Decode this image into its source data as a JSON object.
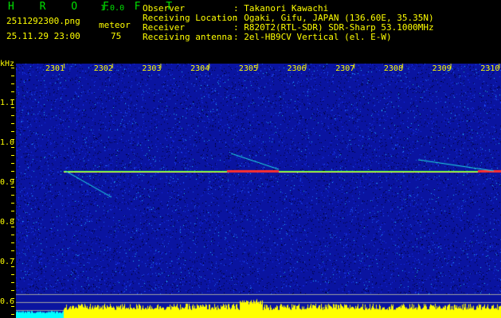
{
  "app": {
    "name": "H R O F F T",
    "version": "1.0.0"
  },
  "file": {
    "name": "2511292300.png",
    "datetime": "25.11.29 23:00"
  },
  "meteor": {
    "label": "meteor",
    "count": "75"
  },
  "info": [
    {
      "key": "Observer",
      "value": ": Takanori Kawachi"
    },
    {
      "key": "Receiving Location",
      "value": ": Ogaki, Gifu, JAPAN (136.60E, 35.35N)"
    },
    {
      "key": "Receiver",
      "value": ": R820T2(RTL-SDR) SDR-Sharp 53.1000MHz"
    },
    {
      "key": "Receiving antenna",
      "value": ": 2el-HB9CV Vertical (el. E-W)"
    }
  ],
  "spectrogram": {
    "y_unit": "kHz",
    "y_ticks": [
      "1.1",
      "1.0",
      "0.9",
      "0.8",
      "0.7",
      "0.6"
    ],
    "x_ticks": [
      "2301",
      "2302",
      "2303",
      "2304",
      "2305",
      "2306",
      "2307",
      "2308",
      "2309",
      "2310"
    ],
    "meteor_echo_frequency_khz": 0.93,
    "colors": {
      "background": "#000000",
      "noise": "#1020c0",
      "text": "#ffff00",
      "echo": "#ff3030",
      "level_bar": "#ffff00",
      "level_bar_low": "#00ffff"
    }
  }
}
